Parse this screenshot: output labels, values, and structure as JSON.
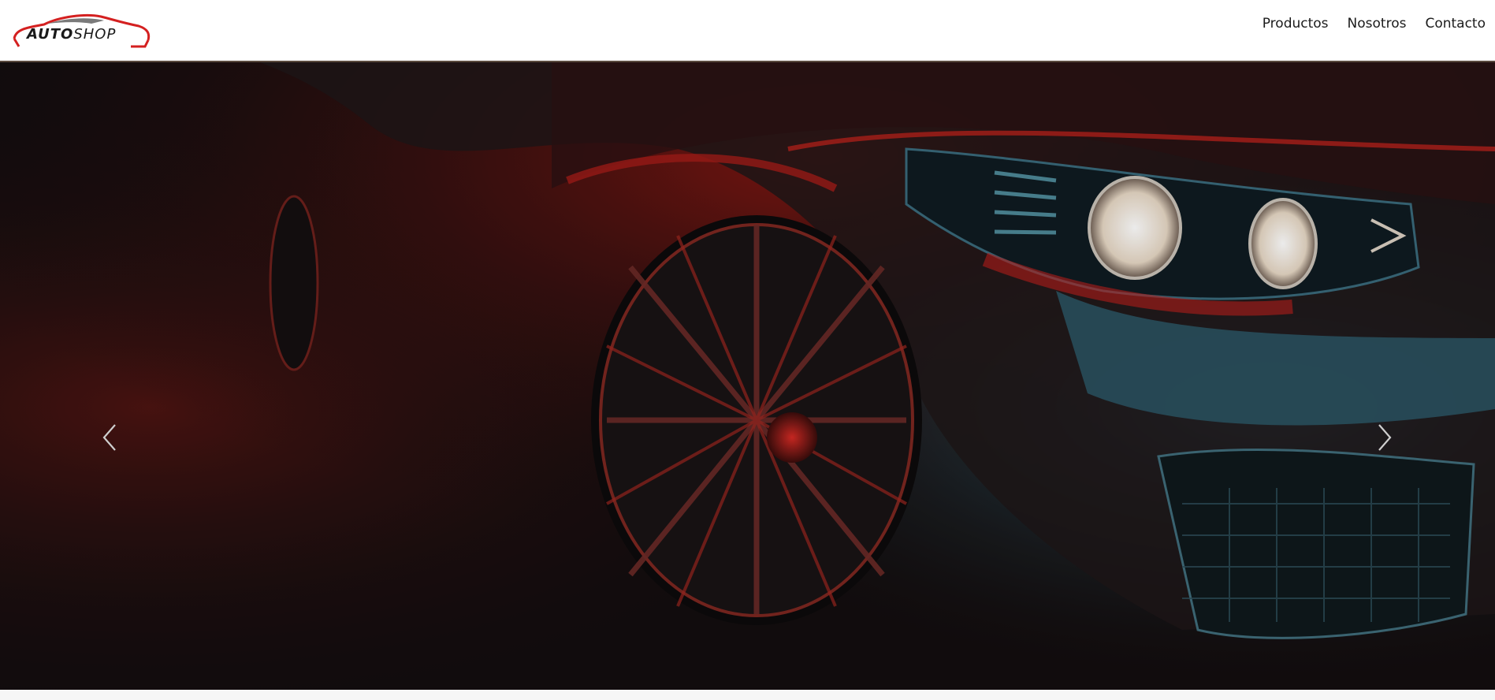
{
  "brand": {
    "logo_text_a": "AUTO",
    "logo_text_b": "SHOP",
    "logo_colors": {
      "swoosh": "#d42020",
      "roof": "#7a7a7a",
      "text": "#1a1a1a"
    }
  },
  "nav": {
    "items": [
      {
        "label": "Productos"
      },
      {
        "label": "Nosotros"
      },
      {
        "label": "Contacto"
      }
    ]
  },
  "hero": {
    "image": "sports-car-red-blue-lighting",
    "prev_icon": "chevron-left-icon",
    "next_icon": "chevron-right-icon",
    "palette": {
      "dark": "#120d0e",
      "red": "#c0201c",
      "teal": "#2f5f6e"
    }
  }
}
